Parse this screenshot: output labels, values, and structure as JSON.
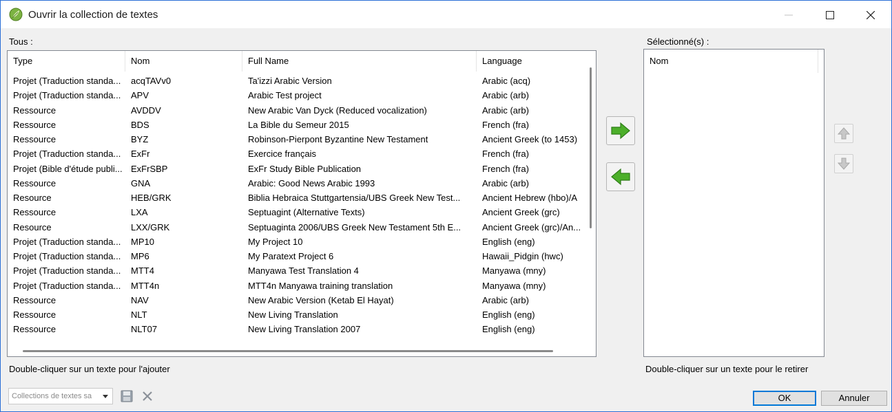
{
  "window": {
    "title": "Ouvrir la collection de textes"
  },
  "left": {
    "label": "Tous :",
    "hint": "Double-cliquer sur un texte pour l'ajouter",
    "columns": [
      "Type",
      "Nom",
      "Full Name",
      "Language"
    ],
    "rows": [
      [
        "Projet (Traduction standa...",
        "acqTAVv0",
        "Ta'izzi Arabic Version",
        "Arabic (acq)"
      ],
      [
        "Projet (Traduction standa...",
        "APV",
        "Arabic Test project",
        "Arabic (arb)"
      ],
      [
        "Ressource",
        "AVDDV",
        "New  Arabic Van Dyck (Reduced vocalization)",
        "Arabic (arb)"
      ],
      [
        "Ressource",
        "BDS",
        "La Bible du Semeur 2015",
        "French (fra)"
      ],
      [
        "Ressource",
        "BYZ",
        "Robinson-Pierpont Byzantine New Testament",
        "Ancient Greek (to 1453)"
      ],
      [
        "Projet (Traduction standa...",
        "ExFr",
        "Exercice français",
        "French (fra)"
      ],
      [
        "Projet (Bible d'étude publi...",
        "ExFrSBP",
        "ExFr Study Bible Publication",
        "French (fra)"
      ],
      [
        "Ressource",
        "GNA",
        "Arabic: Good News Arabic 1993",
        "Arabic (arb)"
      ],
      [
        "Resource",
        "HEB/GRK",
        "Biblia Hebraica Stuttgartensia/UBS Greek New Test...",
        "Ancient Hebrew (hbo)/A"
      ],
      [
        "Ressource",
        "LXA",
        "Septuagint (Alternative Texts)",
        "Ancient Greek (grc)"
      ],
      [
        "Resource",
        "LXX/GRK",
        "Septuaginta 2006/UBS Greek New Testament 5th E...",
        "Ancient Greek (grc)/An..."
      ],
      [
        "Projet (Traduction standa...",
        "MP10",
        "My Project 10",
        "English (eng)"
      ],
      [
        "Projet (Traduction standa...",
        "MP6",
        "My Paratext Project 6",
        "Hawaii_Pidgin (hwc)"
      ],
      [
        "Projet (Traduction standa...",
        "MTT4",
        "Manyawa Test Translation 4",
        "Manyawa (mny)"
      ],
      [
        "Projet (Traduction standa...",
        "MTT4n",
        "MTT4n Manyawa training translation",
        "Manyawa (mny)"
      ],
      [
        "Ressource",
        "NAV",
        "New Arabic Version (Ketab El Hayat)",
        "Arabic (arb)"
      ],
      [
        "Ressource",
        "NLT",
        "New Living Translation",
        "English (eng)"
      ],
      [
        "Ressource",
        "NLT07",
        "New Living Translation 2007",
        "English (eng)"
      ]
    ]
  },
  "right": {
    "label": "Sélectionné(s) :",
    "column": "Nom",
    "hint": "Double-cliquer sur un texte pour le retirer"
  },
  "bottom": {
    "combo_placeholder": "Collections de textes sa",
    "ok": "OK",
    "cancel": "Annuler"
  },
  "colors": {
    "accent": "#0078d7",
    "arrow_green": "#4caf2a"
  }
}
